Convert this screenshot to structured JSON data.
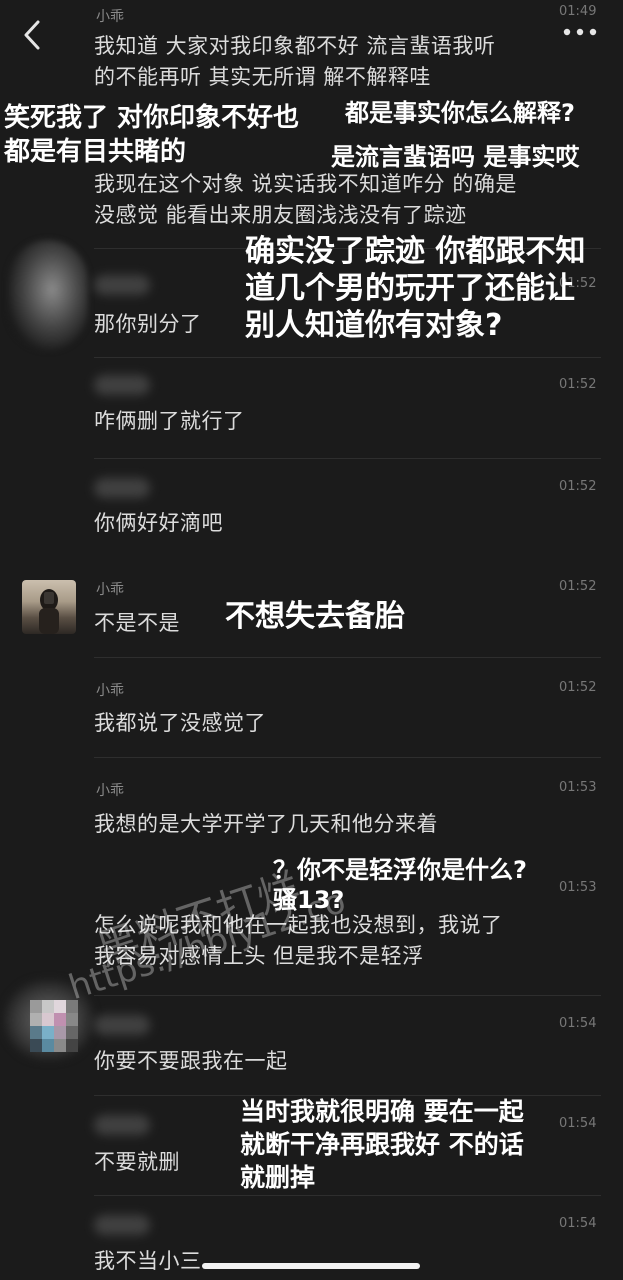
{
  "header": {
    "back_icon": "chevron-left-icon",
    "more_icon": "more-dots-icon"
  },
  "messages": [
    {
      "sender": "小乖",
      "time": "01:49",
      "lines": [
        "我知道 大家对我印象都不好 流言蜚语我听",
        "的不能再听 其实无所谓 解不解释哇"
      ]
    },
    {
      "lines": [
        "我现在这个对象 说实话我不知道咋分 的确是",
        "没感觉 能看出来朋友圈浅浅没有了踪迹"
      ]
    },
    {
      "time": "01:52",
      "text": "那你别分了"
    },
    {
      "time": "01:52",
      "text": "咋俩删了就行了"
    },
    {
      "time": "01:52",
      "text": "你俩好好滴吧"
    },
    {
      "sender": "小乖",
      "time": "01:52",
      "text": "不是不是"
    },
    {
      "sender": "小乖",
      "time": "01:52",
      "text": "我都说了没感觉了"
    },
    {
      "sender": "小乖",
      "time": "01:53",
      "text": "我想的是大学开学了几天和他分来着"
    },
    {
      "time": "01:53",
      "lines": [
        "怎么说呢我和他在一起我也没想到，我说了",
        "我容易对感情上头 但是我不是轻浮"
      ]
    },
    {
      "time": "01:54",
      "text": "你要不要跟我在一起"
    },
    {
      "time": "01:54",
      "text": "不要就删"
    },
    {
      "time": "01:54",
      "text": "我不当小三"
    }
  ],
  "overlays": {
    "left_comment": [
      "笑死我了 对你印象不好也",
      "都是有目共睹的"
    ],
    "right_comment_1": [
      "都是事实你怎么解释?",
      "是流言蜚语吗 是事实哎"
    ],
    "trace_comment": [
      "确实没了踪迹 你都跟不知",
      "道几个男的玩开了还能让",
      "别人知道你有对象?"
    ],
    "backup_comment": "不想失去备胎",
    "frivolous_comment": [
      "？你不是轻浮你是什么?",
      "骚13?"
    ],
    "clear_comment": [
      "当时我就很明确 要在一起",
      "就断干净再跟我好 不的话",
      "就删掉"
    ]
  },
  "watermark": {
    "line1": "黑料不打烊",
    "line2": "https://hbly12.co"
  }
}
